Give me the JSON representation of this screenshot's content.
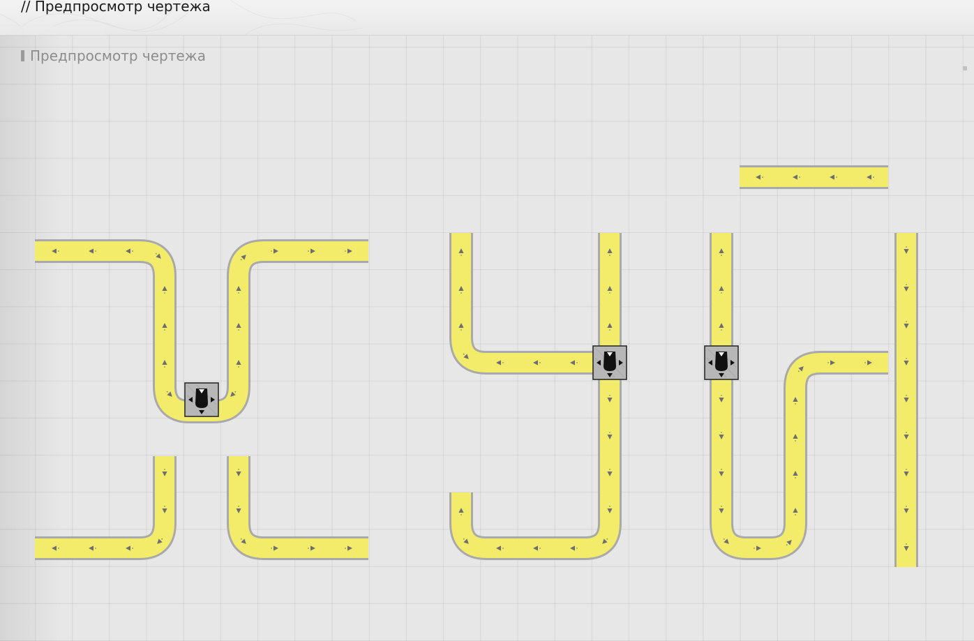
{
  "header": {
    "title": "// Предпросмотр чертежа"
  },
  "section": {
    "title": "Предпросмотр чертежа"
  },
  "colors": {
    "belt_fill": "#f3ec6b",
    "belt_edge": "#a9a9a9",
    "belt_arrow": "#6e6e6e",
    "splitter_body": "#b7b7b7",
    "splitter_border": "#2a2a2a",
    "splitter_icon": "#111111",
    "grid_background": "#e7e7e7"
  },
  "icons": {
    "belt_arrow": "triangle-arrow-icon",
    "splitter": "splitter-icon"
  },
  "blueprint": {
    "belt_count": 12,
    "splitter_count": 3
  }
}
